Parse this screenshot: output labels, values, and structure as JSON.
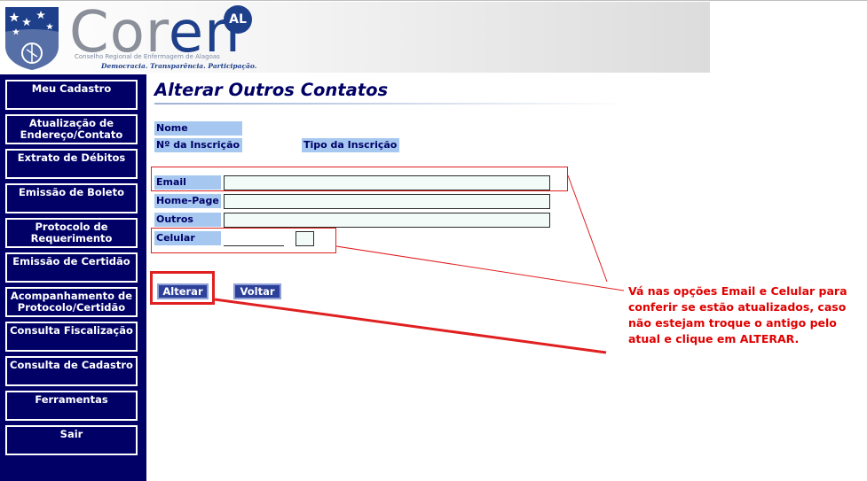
{
  "banner": {
    "logo_word_c": "Cor",
    "logo_word_r": "en",
    "logo_badge": "AL",
    "logo_subtitle": "Conselho Regional de Enfermagem de Alagoas",
    "logo_slogan": "Democracia. Transparência. Participação."
  },
  "sidebar": {
    "items": [
      {
        "label": "Meu Cadastro"
      },
      {
        "label": "Atualização de Endereço/Contato"
      },
      {
        "label": "Extrato de Débitos"
      },
      {
        "label": "Emissão de Boleto"
      },
      {
        "label": "Protocolo de Requerimento"
      },
      {
        "label": "Emissão de Certidão"
      },
      {
        "label": "Acompanhamento de Protocolo/Certidão"
      },
      {
        "label": "Consulta Fiscalização"
      },
      {
        "label": "Consulta de Cadastro"
      },
      {
        "label": "Ferramentas"
      },
      {
        "label": "Sair"
      }
    ]
  },
  "main": {
    "title": "Alterar Outros Contatos",
    "info": {
      "nome_label": "Nome",
      "inscricao_label": "Nº da Inscrição",
      "tipo_label": "Tipo da Inscrição"
    },
    "form": {
      "email_label": "Email",
      "homepage_label": "Home-Page",
      "outros_label": "Outros",
      "celular_label": "Celular",
      "email_value": "",
      "homepage_value": "",
      "outros_value": "",
      "celular_ddd_value": "",
      "celular_value": ""
    },
    "buttons": {
      "alterar": "Alterar",
      "voltar": "Voltar"
    }
  },
  "annotation": {
    "text": "Vá nas opções Email e Celular para conferir se estão atualizados, caso não estejam troque o antigo pelo atual e clique em ALTERAR."
  },
  "colors": {
    "sidebar_bg": "#000066",
    "label_bg": "#a6c8f0",
    "button_bg": "#2c3f99",
    "annotation": "#e00000"
  }
}
